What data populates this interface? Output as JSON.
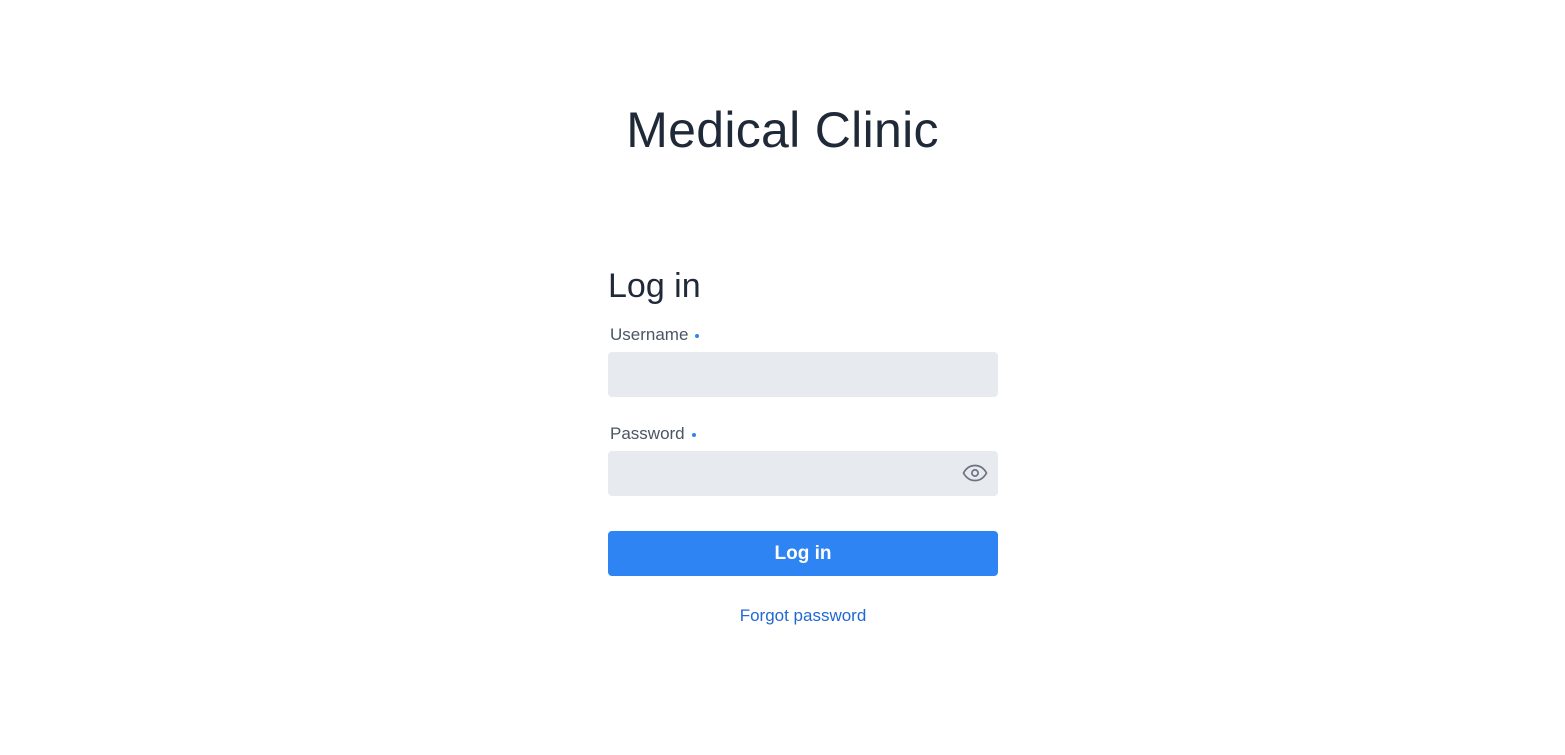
{
  "app": {
    "title": "Medical Clinic"
  },
  "login_form": {
    "heading": "Log in",
    "username": {
      "label": "Username",
      "value": "",
      "placeholder": "",
      "required": true
    },
    "password": {
      "label": "Password",
      "value": "",
      "placeholder": "",
      "required": true,
      "toggle_icon": "eye-icon"
    },
    "submit_label": "Log in",
    "forgot_password_label": "Forgot password"
  },
  "colors": {
    "accent": "#2f84f3",
    "link": "#2268d3",
    "required_dot": "#2f84f3",
    "input_background": "#e7eaee",
    "text_primary": "#1f2937",
    "text_label": "#4b5563",
    "icon": "#6b7280"
  }
}
